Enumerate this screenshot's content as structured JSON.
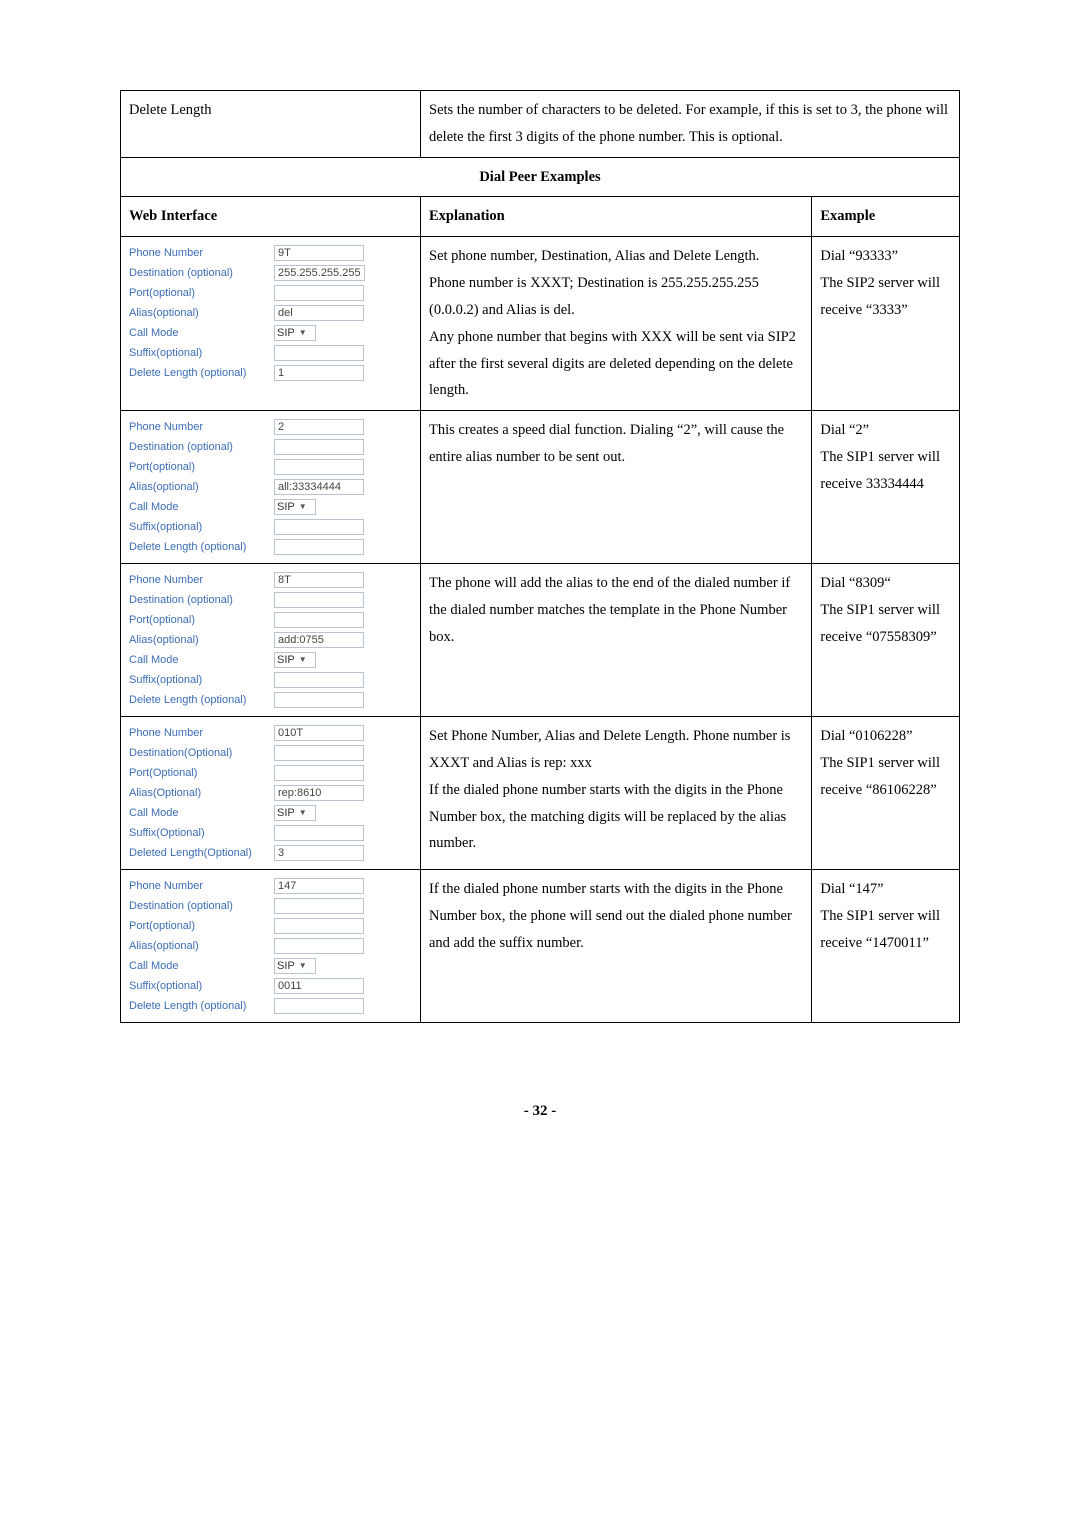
{
  "row0": {
    "label": "Delete Length",
    "desc": "Sets the number of characters to be deleted. For example, if this is set to 3, the phone will delete the first 3 digits of the phone number. This is optional."
  },
  "section": "Dial Peer Examples",
  "headers": {
    "web": "Web Interface",
    "expl": "Explanation",
    "ex": "Example"
  },
  "labels": {
    "phone": "Phone Number",
    "dest": "Destination (optional)",
    "dest2": "Destination(Optional)",
    "port": "Port(optional)",
    "port2": "Port(Optional)",
    "alias": "Alias(optional)",
    "alias2": "Alias(Optional)",
    "call": "Call Mode",
    "suffix": "Suffix(optional)",
    "suffix2": "Suffix(Optional)",
    "del": "Delete Length (optional)",
    "del2": "Deleted Length(Optional)",
    "sip": "SIP"
  },
  "ex1": {
    "fields": {
      "phone": "9T",
      "dest": "255.255.255.255",
      "port": "",
      "alias": "del",
      "suffix": "",
      "del": "1"
    },
    "expl": "Set phone number, Destination, Alias and Delete Length.\nPhone number is XXXT; Destination is 255.255.255.255 (0.0.0.2) and Alias is del.\nAny phone number that begins with XXX will be sent via SIP2 after the first several digits are deleted depending on the delete length.",
    "example": "Dial “93333”\nThe SIP2 server will receive “3333”"
  },
  "ex2": {
    "fields": {
      "phone": "2",
      "dest": "",
      "port": "",
      "alias": "all:33334444",
      "suffix": "",
      "del": ""
    },
    "expl": "This creates a speed dial function.   Dialing “2”, will cause the entire alias number to be sent out.",
    "example": "Dial “2”\nThe SIP1 server will receive 33334444"
  },
  "ex3": {
    "fields": {
      "phone": "8T",
      "dest": "",
      "port": "",
      "alias": "add:0755",
      "suffix": "",
      "del": ""
    },
    "expl": "The phone will add the alias to the end of the dialed number if the dialed number matches the template in the Phone Number box.",
    "example": "Dial “8309“\nThe SIP1 server will receive “07558309”"
  },
  "ex4": {
    "fields": {
      "phone": "010T",
      "dest": "",
      "port": "",
      "alias": "rep:8610",
      "suffix": "",
      "del": "3"
    },
    "expl": "Set Phone Number, Alias and Delete Length. Phone number is XXXT and Alias is rep: xxx\nIf the dialed phone number starts with the digits in the Phone Number box, the matching digits will be replaced by the alias number.",
    "example": "Dial “0106228”\nThe SIP1 server will receive “86106228”"
  },
  "ex5": {
    "fields": {
      "phone": "147",
      "dest": "",
      "port": "",
      "alias": "",
      "suffix": "0011",
      "del": ""
    },
    "expl": "If the dialed phone number starts with the digits in the Phone Number box, the phone will send out the dialed phone number and add the suffix number.",
    "example": "Dial “147”\nThe SIP1 server will receive “1470011”"
  },
  "footer": "- 32 -"
}
